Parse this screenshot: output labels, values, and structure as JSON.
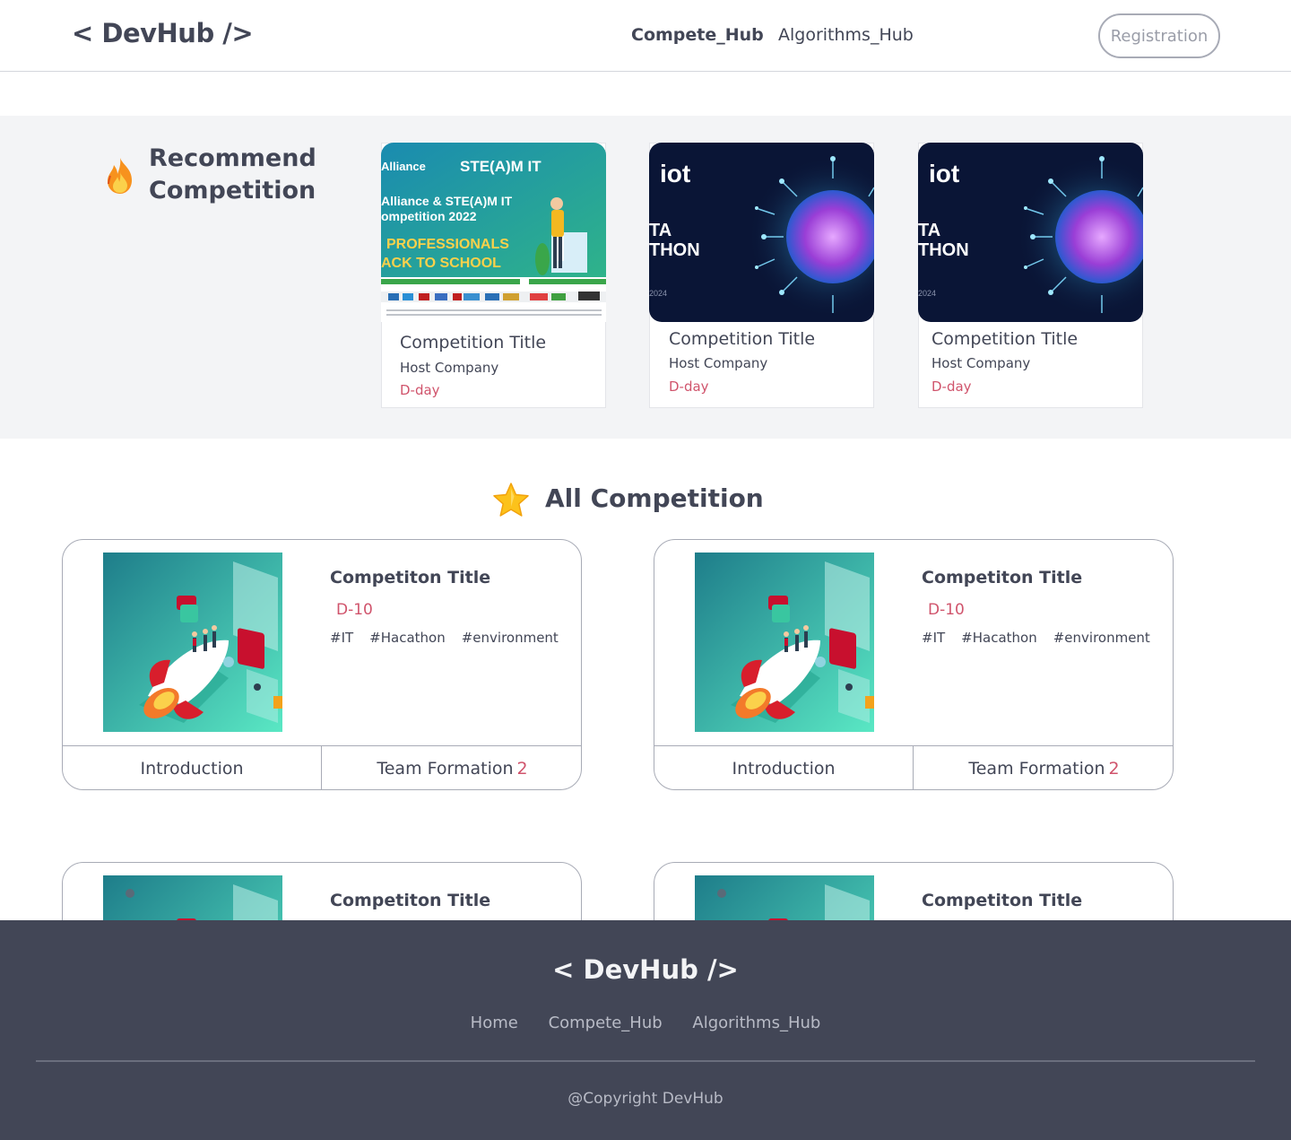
{
  "header": {
    "logo": "< DevHub />",
    "nav": [
      "Compete_Hub",
      "Algorithms_Hub"
    ],
    "registration": "Registration"
  },
  "recommend": {
    "title_line1": "Recommend",
    "title_line2": "Competition",
    "cards": [
      {
        "title": "Competition Title",
        "host": "Host Company",
        "dday": "D-day",
        "poster_lines": [
          "Alliance",
          "STE(A)M IT",
          "Alliance & STE(A)M IT",
          "ompetition 2022",
          "PROFESSIONALS",
          "ACK TO SCHOOL"
        ]
      },
      {
        "title": "Competition Title",
        "host": "Host Company",
        "dday": "D-day",
        "poster_lines": [
          "iot",
          "TA",
          "THON",
          "2024"
        ]
      },
      {
        "title": "Competition Title",
        "host": "Host Company",
        "dday": "D-day",
        "poster_lines": [
          "iot",
          "TA",
          "THON",
          "2024"
        ]
      }
    ]
  },
  "all": {
    "title": "All Competition",
    "cards": [
      {
        "title": "Competiton Title",
        "dday": "D-10",
        "tags": [
          "#IT",
          "#Hacathon",
          "#environment"
        ],
        "intro": "Introduction",
        "team": "Team Formation",
        "team_count": "2"
      },
      {
        "title": "Competiton Title",
        "dday": "D-10",
        "tags": [
          "#IT",
          "#Hacathon",
          "#environment"
        ],
        "intro": "Introduction",
        "team": "Team Formation",
        "team_count": "2"
      },
      {
        "title": "Competiton Title",
        "dday": "",
        "tags": [],
        "intro": "",
        "team": "",
        "team_count": ""
      },
      {
        "title": "Competiton Title",
        "dday": "",
        "tags": [],
        "intro": "",
        "team": "",
        "team_count": ""
      }
    ]
  },
  "footer": {
    "logo": "< DevHub />",
    "links": [
      "Home",
      "Compete_Hub",
      "Algorithms_Hub"
    ],
    "copyright": "@Copyright DevHub"
  },
  "colors": {
    "text": "#424656",
    "accent": "#d0546c",
    "footer_bg": "#424656",
    "section_bg": "#f3f4f6"
  }
}
